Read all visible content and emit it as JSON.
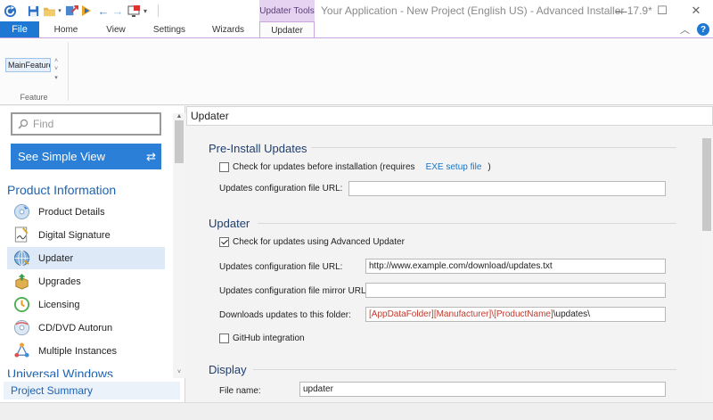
{
  "window": {
    "title": "Your Application - New Project (English US) - Advanced Installer 17.9*",
    "context_tab_group": "Updater Tools",
    "minimize": "—",
    "maximize": "☐",
    "close": "✕"
  },
  "ribbon": {
    "tabs": [
      "File",
      "Home",
      "View",
      "Settings",
      "Wizards",
      "Updater"
    ],
    "active_tab": "Updater",
    "feature_combo_value": "MainFeature",
    "feature_group_label": "Feature"
  },
  "left_pane": {
    "search_placeholder": "Find",
    "simple_view_button": "See Simple View",
    "section_title": "Product Information",
    "items": [
      {
        "label": "Product Details",
        "icon": "cd-icon"
      },
      {
        "label": "Digital Signature",
        "icon": "signature-icon"
      },
      {
        "label": "Updater",
        "icon": "globe-icon",
        "selected": true
      },
      {
        "label": "Upgrades",
        "icon": "upgrade-box-icon"
      },
      {
        "label": "Licensing",
        "icon": "license-icon"
      },
      {
        "label": "CD/DVD Autorun",
        "icon": "disc-icon"
      },
      {
        "label": "Multiple Instances",
        "icon": "instances-icon"
      }
    ],
    "next_section_title": "Universal Windows",
    "project_summary": "Project Summary"
  },
  "main": {
    "header": "Updater",
    "pre_install": {
      "title": "Pre-Install Updates",
      "check_label": "Check for updates before installation (requires",
      "check_link": "EXE setup file",
      "check_suffix": ")",
      "checked": false,
      "config_url_label": "Updates configuration file URL:",
      "config_url_value": ""
    },
    "updater": {
      "title": "Updater",
      "check_label": "Check for updates using Advanced Updater",
      "checked": true,
      "config_url_label": "Updates configuration file URL:",
      "config_url_value": "http://www.example.com/download/updates.txt",
      "mirror_url_label": "Updates configuration file mirror URL:",
      "mirror_url_value": "",
      "folder_label": "Downloads updates to this folder:",
      "folder_value_red": "[AppDataFolder][Manufacturer]\\[ProductName]",
      "folder_value_rest": "\\updates\\",
      "github_label": "GitHub integration",
      "github_checked": false
    },
    "display": {
      "title": "Display",
      "file_name_label": "File name:",
      "file_name_value": "updater"
    }
  },
  "colors": {
    "accent_blue": "#1e78d3",
    "context_tab_purple": "#e6d3f2",
    "section_text_blue": "#1d63b3",
    "variable_red": "#c0392b"
  }
}
